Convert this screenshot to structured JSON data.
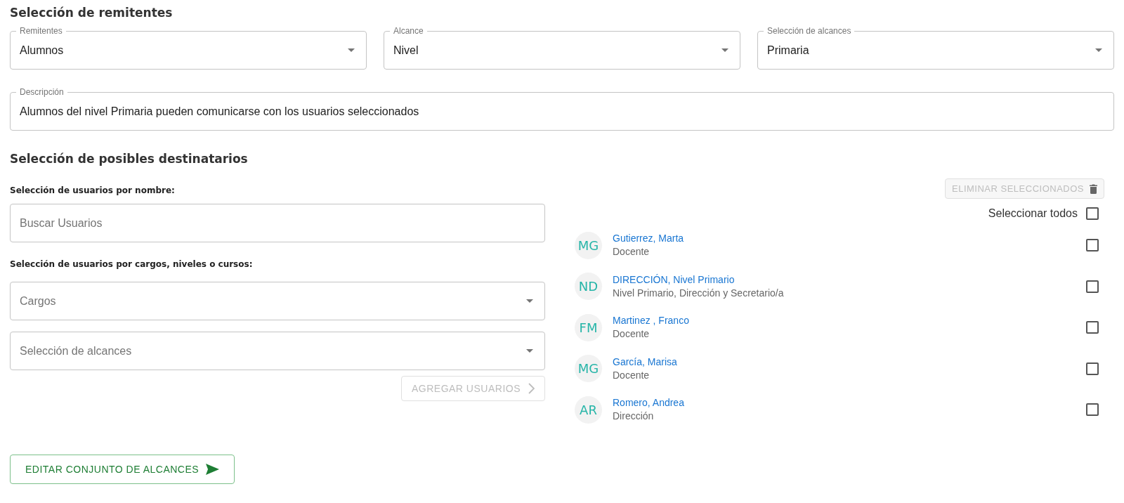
{
  "sender_section": {
    "title": "Selección de remitentes",
    "selects": [
      {
        "label": "Remitentes",
        "value": "Alumnos"
      },
      {
        "label": "Alcance",
        "value": "Nivel"
      },
      {
        "label": "Selección de alcances",
        "value": "Primaria"
      }
    ],
    "description": {
      "label": "Descripción",
      "value": "Alumnos del nivel Primaria pueden comunicarse con los usuarios seleccionados"
    }
  },
  "recipients_section": {
    "title": "Selección de posibles destinatarios",
    "by_name": {
      "label": "Selección de usuarios por nombre:",
      "placeholder": "Buscar Usuarios"
    },
    "by_role": {
      "label": "Selección de usuarios por cargos, niveles o cursos:",
      "selects": [
        {
          "placeholder": "Cargos"
        },
        {
          "placeholder": "Selección de alcances"
        }
      ]
    },
    "add_button": {
      "label": "AGREGAR USUARIOS",
      "disabled": true
    },
    "delete_button": {
      "label": "ELIMINAR SELECCIONADOS",
      "disabled": true
    },
    "select_all": {
      "label": "Seleccionar todos",
      "checked": false
    },
    "users": [
      {
        "initials": "MG",
        "name": "Gutierrez, Marta",
        "role": "Docente",
        "checked": false
      },
      {
        "initials": "ND",
        "name": "DIRECCIÓN, Nivel Primario",
        "role": "Nivel Primario, Dirección y Secretario/a",
        "checked": false
      },
      {
        "initials": "FM",
        "name": "Martinez , Franco",
        "role": "Docente",
        "checked": false
      },
      {
        "initials": "MG",
        "name": "García, Marisa",
        "role": "Docente",
        "checked": false
      },
      {
        "initials": "AR",
        "name": "Romero, Andrea",
        "role": "Dirección",
        "checked": false
      }
    ]
  },
  "submit_button": {
    "label": "EDITAR CONJUNTO DE ALCANCES"
  }
}
